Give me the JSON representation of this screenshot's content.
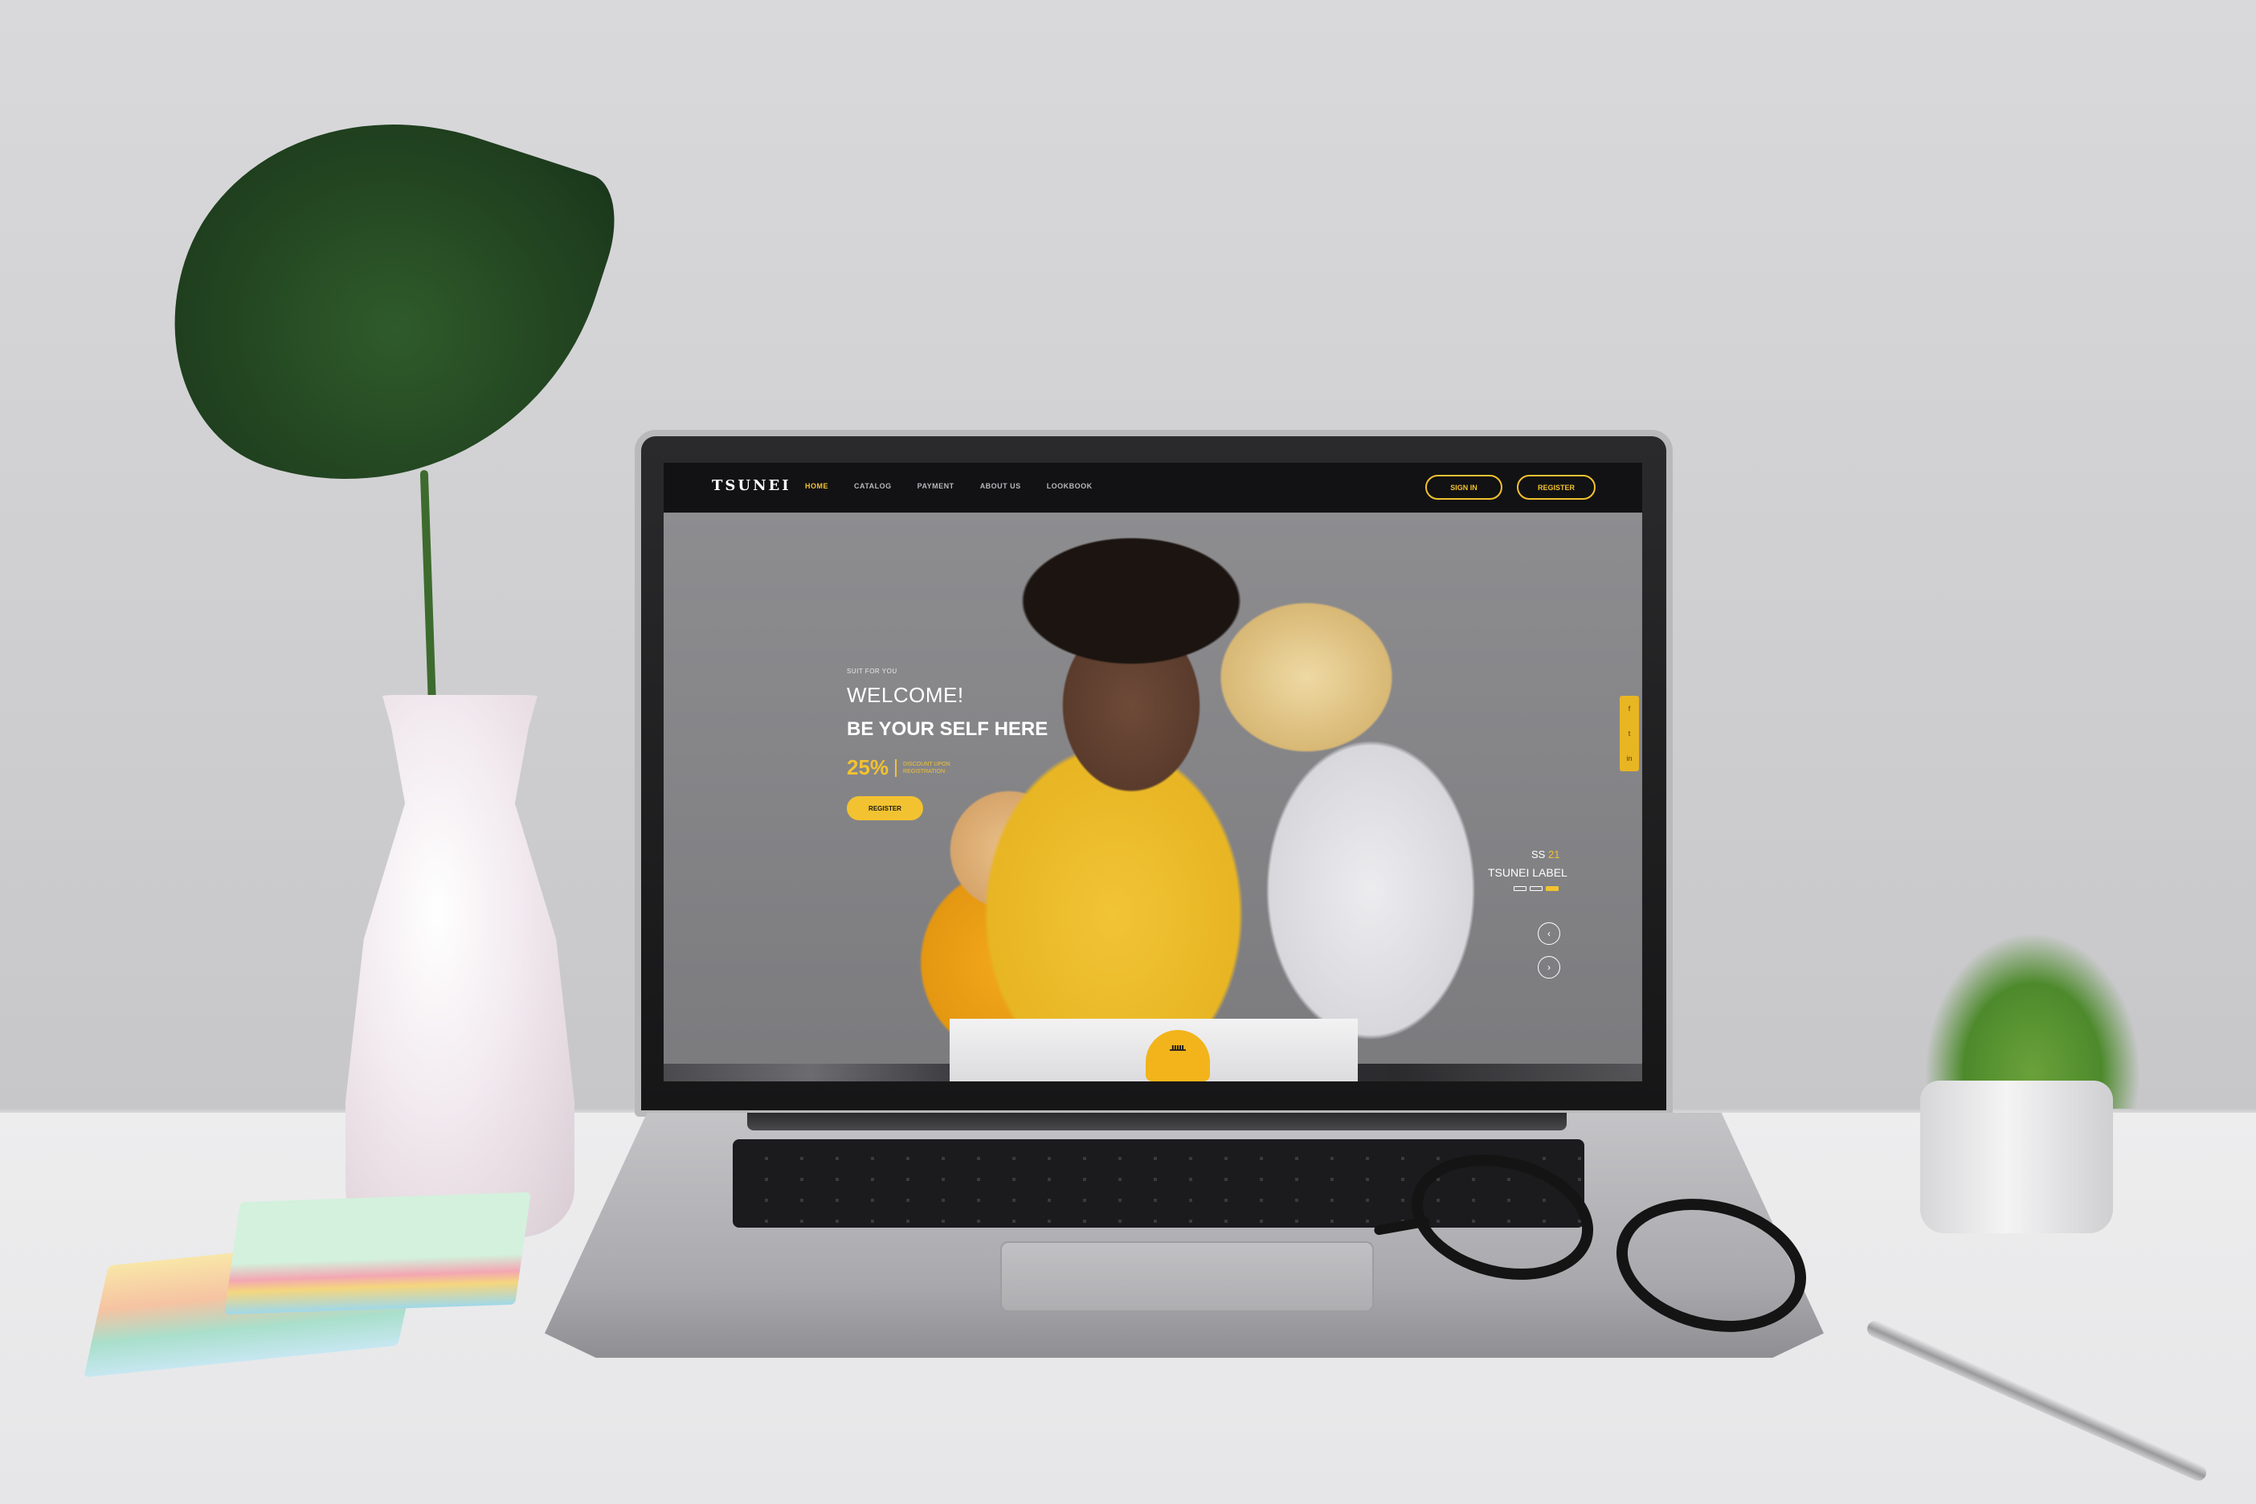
{
  "site": {
    "brand": "TSUNEI",
    "nav": {
      "items": [
        {
          "label": "HOME",
          "active": true
        },
        {
          "label": "CATALOG",
          "active": false
        },
        {
          "label": "PAYMENT",
          "active": false
        },
        {
          "label": "ABOUT US",
          "active": false
        },
        {
          "label": "LOOKBOOK",
          "active": false
        }
      ],
      "sign_in": "SIGN IN",
      "register": "REGISTER"
    },
    "hero": {
      "kicker": "SUIT FOR YOU",
      "title_line1": "WELCOME!",
      "title_line2": "BE YOUR SELF HERE",
      "discount_value": "25%",
      "discount_text": "DISCOUNT UPON REGISTRATION",
      "cta": "REGISTER"
    },
    "slide": {
      "season_prefix": "SS",
      "season_number": "21",
      "label": "TSUNEI LABEL",
      "arrow_prev": "‹",
      "arrow_next": "›"
    },
    "social": [
      "f",
      "t",
      "in"
    ],
    "product_logo": "ᚊ"
  },
  "colors": {
    "accent": "#f2c230",
    "nav_bg": "#121214"
  }
}
